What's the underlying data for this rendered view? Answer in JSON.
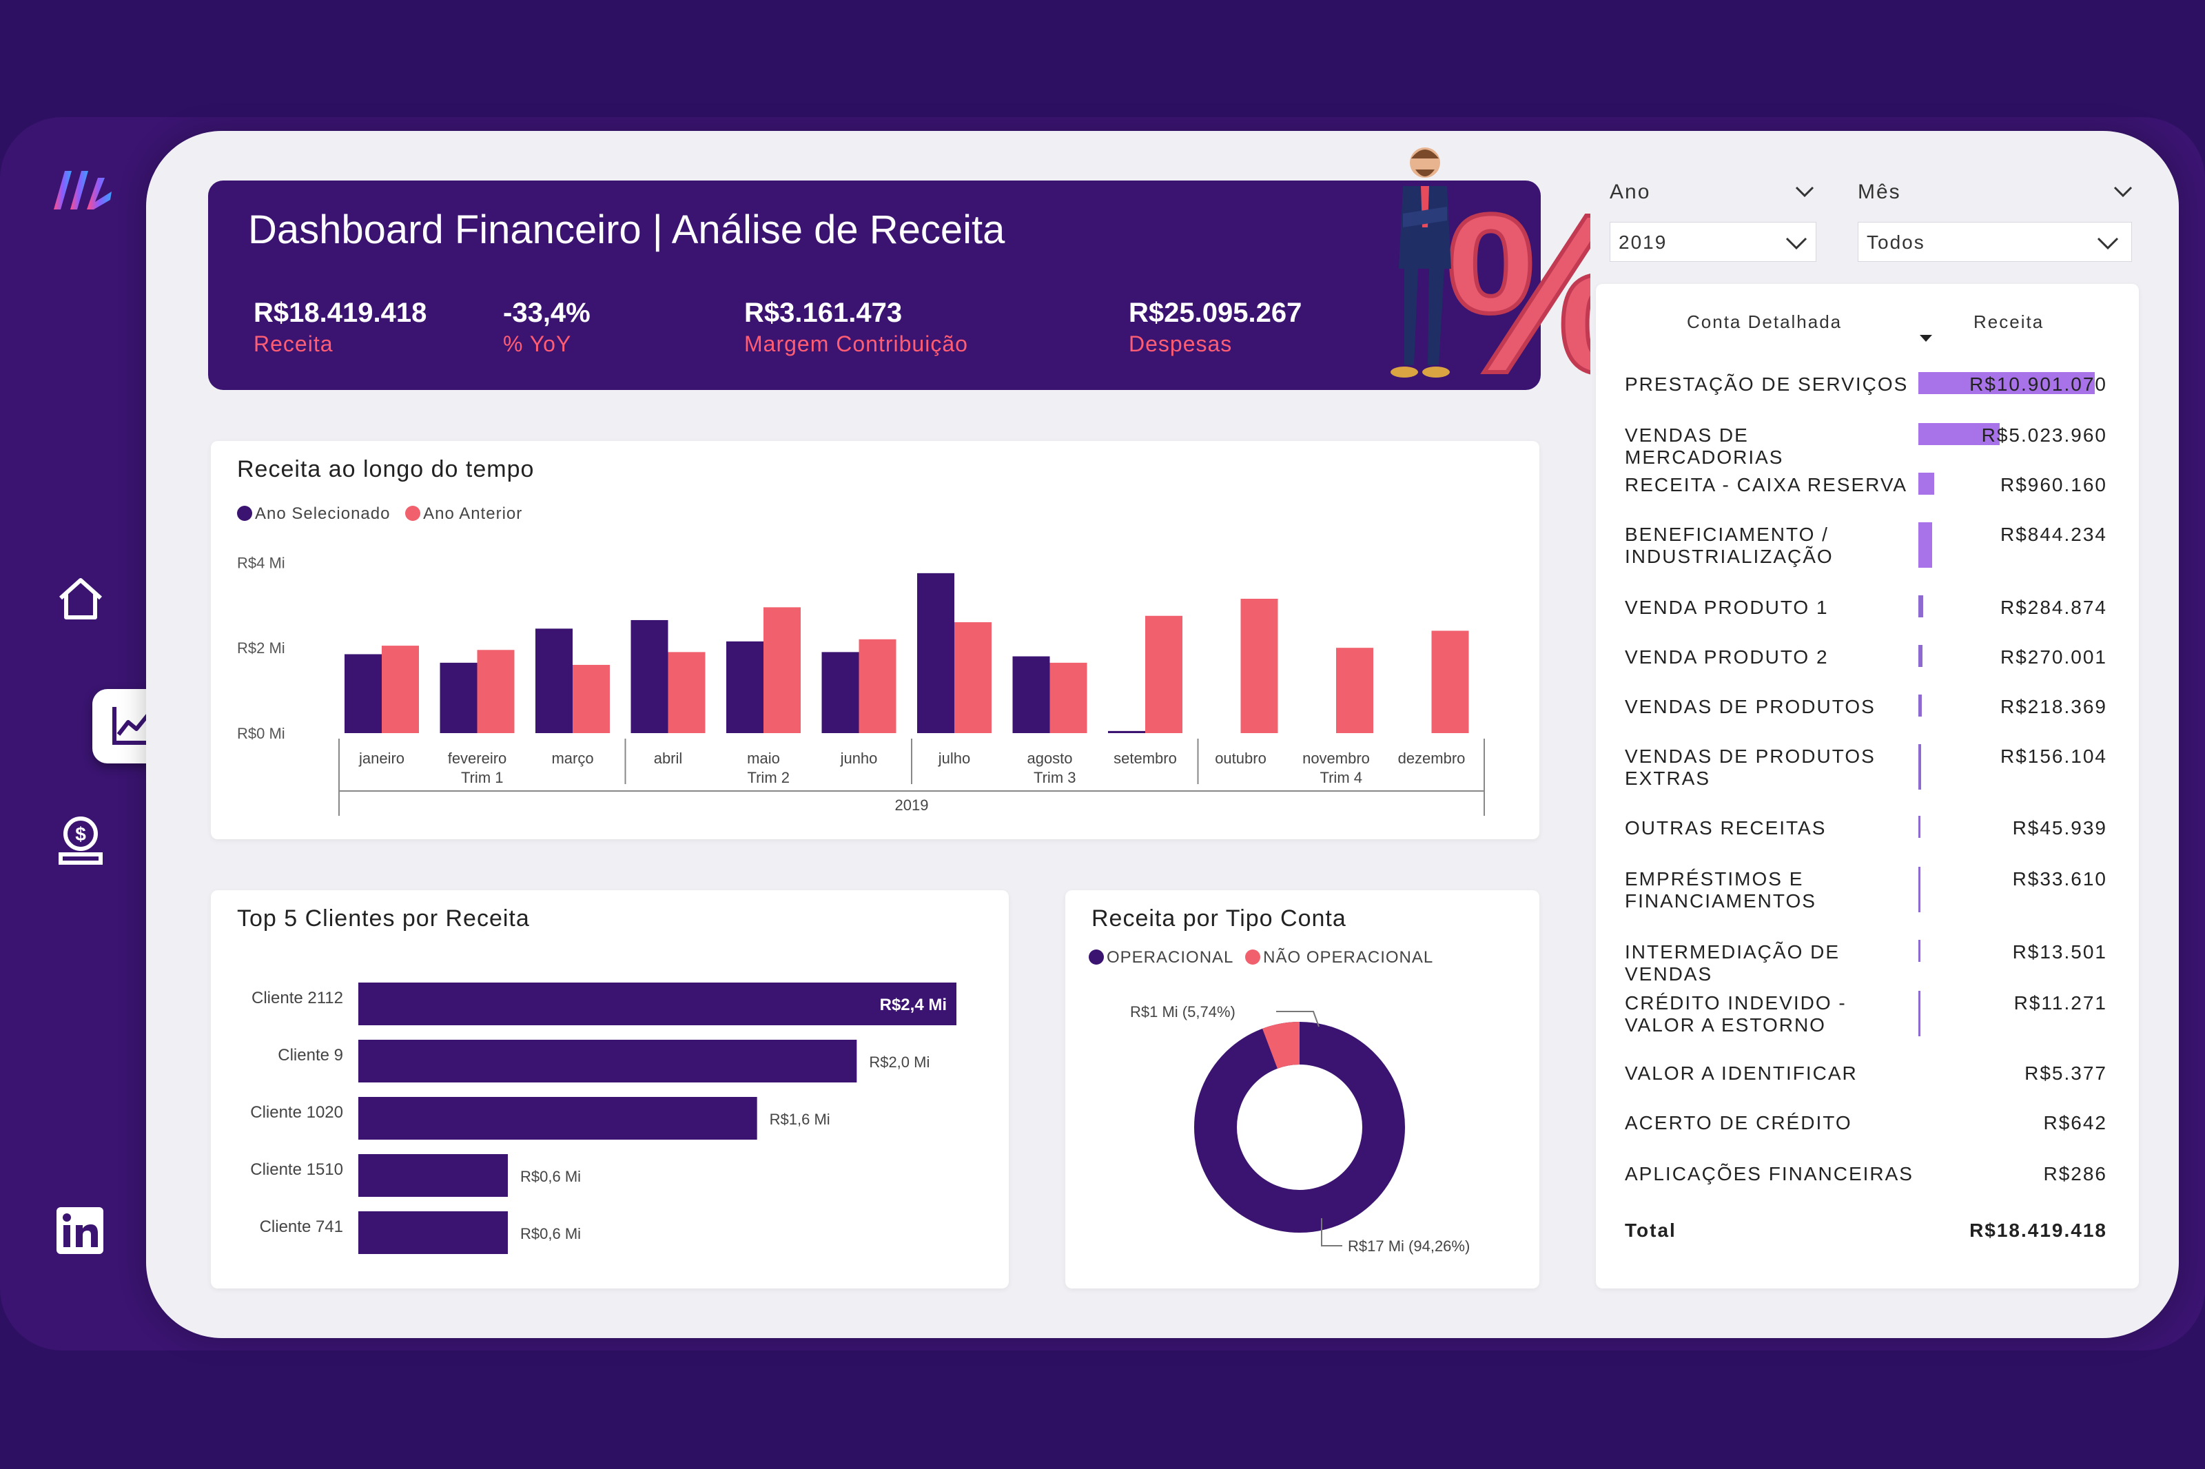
{
  "header": {
    "title": "Dashboard Financeiro | Análise de Receita",
    "kpis": [
      {
        "value": "R$18.419.418",
        "label": "Receita"
      },
      {
        "value": "-33,4%",
        "label": "% YoY"
      },
      {
        "value": "R$3.161.473",
        "label": "Margem Contribuição"
      },
      {
        "value": "R$25.095.267",
        "label": "Despesas"
      }
    ]
  },
  "filters": {
    "year": {
      "label": "Ano",
      "value": "2019"
    },
    "month": {
      "label": "Mês",
      "value": "Todos"
    }
  },
  "colors": {
    "primary": "#3a1470",
    "accent": "#f0616d",
    "bar_light": "#a873e8"
  },
  "sidebar": {
    "icons": [
      "logo-icon",
      "home-icon",
      "chart-line-icon",
      "money-icon",
      "linkedin-icon"
    ]
  },
  "time_chart": {
    "title": "Receita ao longo do tempo",
    "legend": [
      "Ano Selecionado",
      "Ano Anterior"
    ],
    "y_ticks": [
      "R$4 Mi",
      "R$2 Mi",
      "R$0 Mi"
    ],
    "quarter_labels": [
      "Trim 1",
      "Trim 2",
      "Trim 3",
      "Trim 4"
    ],
    "year_label": "2019"
  },
  "clients_chart": {
    "title": "Top 5 Clientes por Receita",
    "value_labels": [
      "R$2,4 Mi",
      "R$2,0 Mi",
      "R$1,6 Mi",
      "R$0,6 Mi",
      "R$0,6 Mi"
    ]
  },
  "donut_chart": {
    "title": "Receita por Tipo Conta",
    "legend": [
      "OPERACIONAL",
      "NÃO OPERACIONAL"
    ],
    "labels": [
      "R$1 Mi (5,74%)",
      "R$17 Mi (94,26%)"
    ]
  },
  "table": {
    "col_account": "Conta Detalhada",
    "col_revenue": "Receita",
    "rows": [
      {
        "name": "PRESTAÇÃO DE SERVIÇOS",
        "value": "R$10.901.070",
        "amount": 10901070
      },
      {
        "name": "VENDAS DE MERCADORIAS",
        "value": "R$5.023.960",
        "amount": 5023960
      },
      {
        "name": "RECEITA - CAIXA RESERVA",
        "value": "R$960.160",
        "amount": 960160
      },
      {
        "name": "BENEFICIAMENTO / INDUSTRIALIZAÇÃO",
        "value": "R$844.234",
        "amount": 844234
      },
      {
        "name": "VENDA PRODUTO 1",
        "value": "R$284.874",
        "amount": 284874
      },
      {
        "name": "VENDA PRODUTO 2",
        "value": "R$270.001",
        "amount": 270001
      },
      {
        "name": "VENDAS DE PRODUTOS",
        "value": "R$218.369",
        "amount": 218369
      },
      {
        "name": "VENDAS DE PRODUTOS EXTRAS",
        "value": "R$156.104",
        "amount": 156104
      },
      {
        "name": "OUTRAS RECEITAS",
        "value": "R$45.939",
        "amount": 45939
      },
      {
        "name": "EMPRÉSTIMOS E FINANCIAMENTOS",
        "value": "R$33.610",
        "amount": 33610
      },
      {
        "name": "INTERMEDIAÇÃO DE VENDAS",
        "value": "R$13.501",
        "amount": 13501
      },
      {
        "name": "CRÉDITO INDEVIDO - VALOR A ESTORNO",
        "value": "R$11.271",
        "amount": 11271
      },
      {
        "name": "VALOR A IDENTIFICAR",
        "value": "R$5.377",
        "amount": 5377
      },
      {
        "name": "ACERTO DE CRÉDITO",
        "value": "R$642",
        "amount": 642
      },
      {
        "name": "APLICAÇÕES FINANCEIRAS",
        "value": "R$286",
        "amount": 286
      }
    ],
    "total_label": "Total",
    "total_value": "R$18.419.418"
  },
  "chart_data": [
    {
      "type": "bar",
      "title": "Receita ao longo do tempo",
      "categories": [
        "janeiro",
        "fevereiro",
        "março",
        "abril",
        "maio",
        "junho",
        "julho",
        "agosto",
        "setembro",
        "outubro",
        "novembro",
        "dezembro"
      ],
      "series": [
        {
          "name": "Ano Selecionado",
          "values": [
            1.85,
            1.65,
            2.45,
            2.65,
            2.15,
            1.9,
            3.75,
            1.8,
            0.05,
            0,
            0,
            0
          ]
        },
        {
          "name": "Ano Anterior",
          "values": [
            2.05,
            1.95,
            1.6,
            1.9,
            2.95,
            2.2,
            2.6,
            1.65,
            2.75,
            3.15,
            2.0,
            2.4
          ]
        }
      ],
      "ylim": [
        0,
        4.2
      ],
      "ylabel": ""
    },
    {
      "type": "bar",
      "title": "Top 5 Clientes por Receita",
      "categories": [
        "Cliente 2112",
        "Cliente 9",
        "Cliente 1020",
        "Cliente 1510",
        "Cliente 741"
      ],
      "values": [
        2.4,
        2.0,
        1.6,
        0.6,
        0.6
      ]
    },
    {
      "type": "pie",
      "title": "Receita por Tipo Conta",
      "categories": [
        "OPERACIONAL",
        "NÃO OPERACIONAL"
      ],
      "values": [
        94.26,
        5.74
      ]
    }
  ]
}
